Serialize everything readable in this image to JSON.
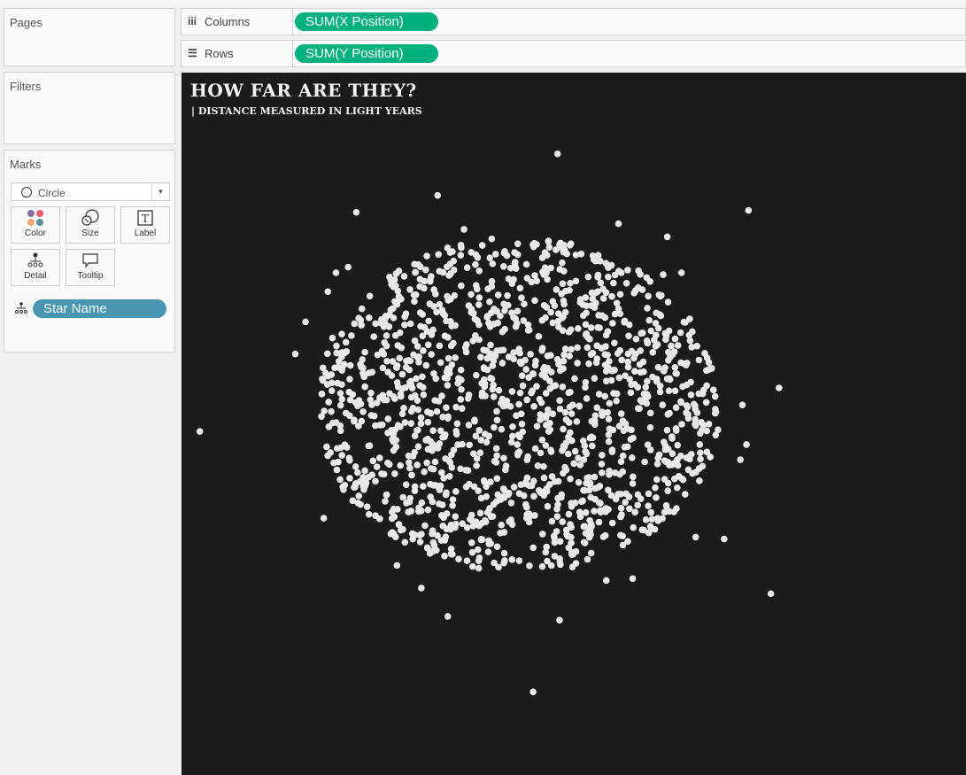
{
  "panels": {
    "pages": "Pages",
    "filters": "Filters",
    "marks": "Marks"
  },
  "marks": {
    "mark_type": "Circle",
    "buttons": [
      "Color",
      "Size",
      "Label",
      "Detail",
      "Tooltip"
    ],
    "detail_pill": "Star Name"
  },
  "shelves": {
    "columns_label": "Columns",
    "columns_pill": "SUM(X Position)",
    "rows_label": "Rows",
    "rows_pill": "SUM(Y Position)"
  },
  "colors": {
    "measure_pill": "#00b180",
    "dimension_pill": "#4996b2",
    "background": "#1b1b1b",
    "point": "#e8e8e8"
  },
  "chart_data": {
    "type": "scatter",
    "title": "HOW FAR ARE THEY?",
    "subtitle": "| DISTANCE MEASURED IN LIGHT YEARS",
    "xlabel": "X Position",
    "ylabel": "Y Position",
    "xlim": [
      -1.66,
      2.2
    ],
    "ylim": [
      -1.96,
      1.76
    ],
    "grid": false,
    "cluster": {
      "shape": "ellipse",
      "center": [
        0,
        0
      ],
      "x_radius": 1.0,
      "y_radius": 0.89,
      "approx_points": 1400
    },
    "outliers": [
      [
        0.19,
        1.33
      ],
      [
        -0.4,
        1.11
      ],
      [
        -0.8,
        1.02
      ],
      [
        1.13,
        1.03
      ],
      [
        -0.27,
        0.93
      ],
      [
        0.49,
        0.96
      ],
      [
        0.73,
        0.89
      ],
      [
        -0.84,
        0.73
      ],
      [
        -0.9,
        0.7
      ],
      [
        -0.94,
        0.6
      ],
      [
        0.8,
        0.7
      ],
      [
        0.71,
        0.69
      ],
      [
        -1.05,
        0.44
      ],
      [
        -1.1,
        0.27
      ],
      [
        1.28,
        0.09
      ],
      [
        -1.57,
        -0.14
      ],
      [
        1.1,
        0.0
      ],
      [
        1.12,
        -0.21
      ],
      [
        1.09,
        -0.29
      ],
      [
        -0.96,
        -0.6
      ],
      [
        0.87,
        -0.7
      ],
      [
        1.01,
        -0.71
      ],
      [
        1.24,
        -1.0
      ],
      [
        -0.48,
        -0.97
      ],
      [
        -0.6,
        -0.85
      ],
      [
        0.43,
        -0.93
      ],
      [
        0.56,
        -0.92
      ],
      [
        -0.35,
        -1.12
      ],
      [
        0.2,
        -1.14
      ],
      [
        0.07,
        -1.52
      ]
    ]
  }
}
